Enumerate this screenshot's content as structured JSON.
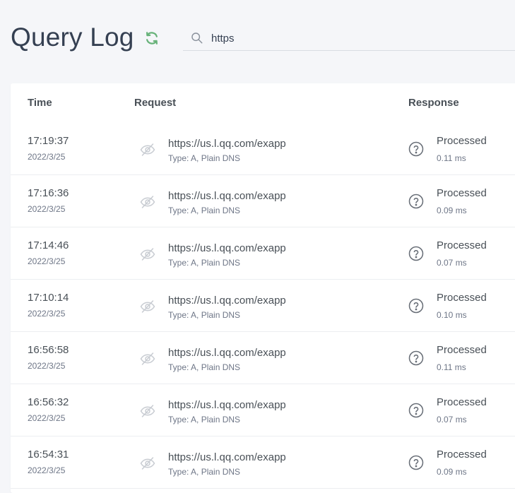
{
  "header": {
    "title": "Query Log",
    "refresh_icon": "refresh-icon",
    "search": {
      "value": "https",
      "placeholder": ""
    }
  },
  "table": {
    "columns": {
      "time": "Time",
      "request": "Request",
      "response": "Response"
    },
    "rows": [
      {
        "time": "17:19:37",
        "date": "2022/3/25",
        "domain": "https://us.l.qq.com/exapp",
        "type": "Type: A, Plain DNS",
        "status": "Processed",
        "elapsed": "0.11 ms"
      },
      {
        "time": "17:16:36",
        "date": "2022/3/25",
        "domain": "https://us.l.qq.com/exapp",
        "type": "Type: A, Plain DNS",
        "status": "Processed",
        "elapsed": "0.09 ms"
      },
      {
        "time": "17:14:46",
        "date": "2022/3/25",
        "domain": "https://us.l.qq.com/exapp",
        "type": "Type: A, Plain DNS",
        "status": "Processed",
        "elapsed": "0.07 ms"
      },
      {
        "time": "17:10:14",
        "date": "2022/3/25",
        "domain": "https://us.l.qq.com/exapp",
        "type": "Type: A, Plain DNS",
        "status": "Processed",
        "elapsed": "0.10 ms"
      },
      {
        "time": "16:56:58",
        "date": "2022/3/25",
        "domain": "https://us.l.qq.com/exapp",
        "type": "Type: A, Plain DNS",
        "status": "Processed",
        "elapsed": "0.11 ms"
      },
      {
        "time": "16:56:32",
        "date": "2022/3/25",
        "domain": "https://us.l.qq.com/exapp",
        "type": "Type: A, Plain DNS",
        "status": "Processed",
        "elapsed": "0.07 ms"
      },
      {
        "time": "16:54:31",
        "date": "2022/3/25",
        "domain": "https://us.l.qq.com/exapp",
        "type": "Type: A, Plain DNS",
        "status": "Processed",
        "elapsed": "0.09 ms"
      }
    ]
  },
  "icons": {
    "request_icon": "eye-slash-icon",
    "response_icon": "question-circle-icon",
    "search_icon": "search-icon"
  },
  "colors": {
    "accent": "#67b279",
    "text": "#495057",
    "muted": "#6e7687",
    "background": "#f5f6f9"
  }
}
